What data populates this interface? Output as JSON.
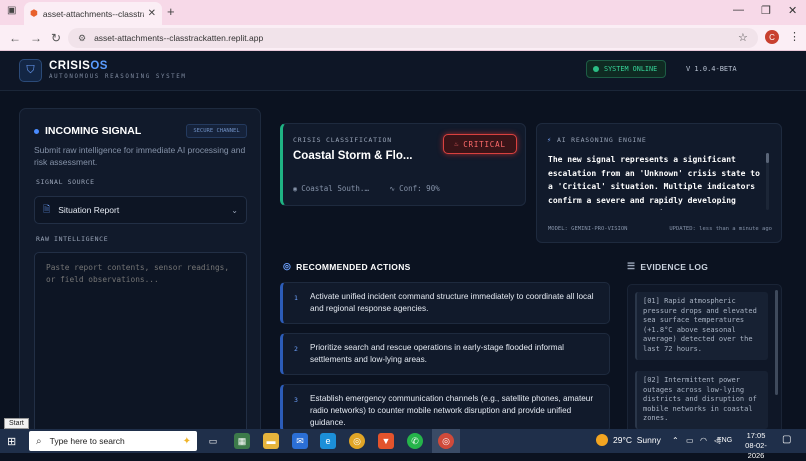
{
  "browser": {
    "tab_title": "asset-attachments--classtrackatten",
    "url": "asset-attachments--classtrackatten.replit.app",
    "profile_initial": "C"
  },
  "header": {
    "brand_prefix": "CRISIS",
    "brand_suffix": "OS",
    "tagline": "AUTONOMOUS REASONING SYSTEM",
    "status": "SYSTEM ONLINE",
    "version": "V 1.0.4-BETA"
  },
  "incoming": {
    "title": "INCOMING SIGNAL",
    "badge": "SECURE CHANNEL",
    "subtitle": "Submit raw intelligence for immediate AI processing and risk assessment.",
    "source_label": "SIGNAL SOURCE",
    "source_value": "Situation Report",
    "raw_label": "RAW INTELLIGENCE",
    "raw_placeholder": "Paste report contents, sensor readings, or field observations..."
  },
  "classification": {
    "label": "CRISIS CLASSIFICATION",
    "title": "Coastal Storm & Flo...",
    "severity": "CRITICAL",
    "location": "Coastal South...",
    "confidence": "Conf: 90%"
  },
  "ai_engine": {
    "title": "AI REASONING ENGINE",
    "text": "The new signal represents a significant escalation from an 'Unknown' crisis state to a 'Critical' situation. Multiple indicators confirm a severe and rapidly developing coastal storm and flooding",
    "model": "MODEL: GEMINI-PRO-VISION",
    "updated": "UPDATED: less than a minute ago"
  },
  "actions": {
    "title": "RECOMMENDED ACTIONS",
    "items": [
      {
        "num": "1",
        "text": "Activate unified incident command structure immediately to coordinate all local and regional response agencies."
      },
      {
        "num": "2",
        "text": "Prioritize search and rescue operations in early-stage flooded informal settlements and low-lying areas."
      },
      {
        "num": "3",
        "text": "Establish emergency communication channels (e.g., satellite phones, amateur radio networks) to counter mobile network disruption and provide unified guidance."
      }
    ]
  },
  "evidence": {
    "title": "EVIDENCE LOG",
    "items": [
      {
        "text": "[01] Rapid atmospheric pressure drops and elevated sea surface temperatures (+1.8°C above seasonal average) detected over the last 72 hours."
      },
      {
        "text": "[02] Intermittent power outages across low-lying districts and disruption of mobile networks in coastal zones."
      }
    ]
  },
  "taskbar": {
    "search_placeholder": "Type here to search",
    "temperature": "29°C",
    "weather": "Sunny",
    "language": "ENG",
    "time": "17:05",
    "date": "08-02-2026",
    "start_tooltip": "Start"
  },
  "colors": {
    "accent": "#5a9cff",
    "online": "#36d399",
    "critical": "#ff6b6b",
    "background": "#0b1220"
  }
}
